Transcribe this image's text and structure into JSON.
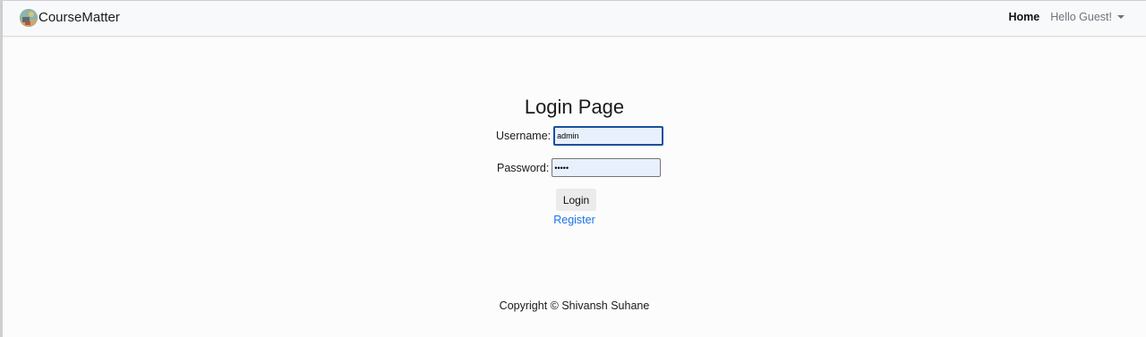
{
  "navbar": {
    "brand": "CourseMatter",
    "home_label": "Home",
    "user_label": "Hello Guest!"
  },
  "page": {
    "title": "Login Page"
  },
  "form": {
    "username_label": "Username:",
    "username_value": "admin",
    "password_label": "Password:",
    "password_value": "•••••",
    "login_label": "Login",
    "register_label": "Register"
  },
  "footer": {
    "copyright": "Copyright © Shivansh Suhane"
  },
  "colors": {
    "link": "#1a73e8",
    "input_bg": "#e8f0fd",
    "focus_border": "#1c4f9c"
  }
}
